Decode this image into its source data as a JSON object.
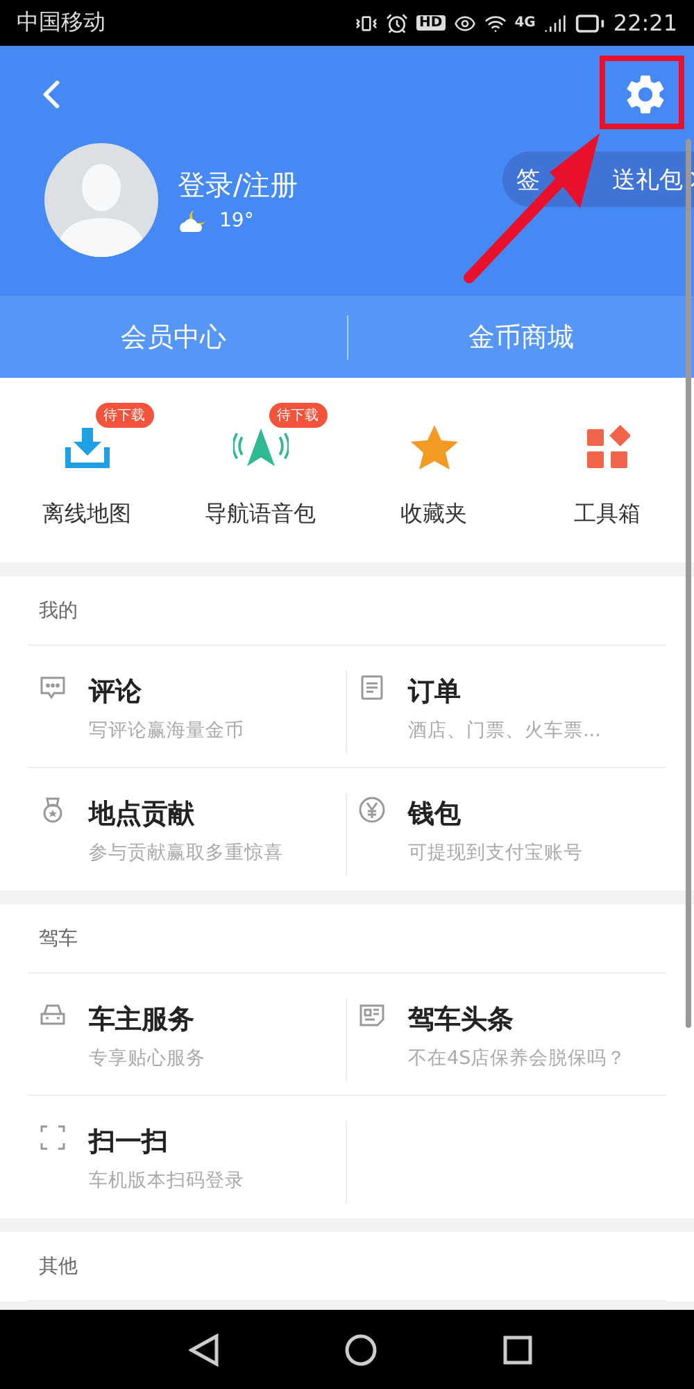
{
  "status_bar": {
    "carrier": "中国移动",
    "hd_label": "HD",
    "network": "4G",
    "time": "22:21"
  },
  "profile": {
    "name": "登录/注册",
    "temperature": "19°",
    "sign_in_parts": [
      "签",
      "送礼包"
    ]
  },
  "member_tabs": [
    {
      "label": "会员中心"
    },
    {
      "label": "金币商城"
    }
  ],
  "shortcuts": [
    {
      "label": "离线地图",
      "badge": "待下载",
      "kind": "download"
    },
    {
      "label": "导航语音包",
      "badge": "待下载",
      "kind": "voice"
    },
    {
      "label": "收藏夹",
      "kind": "star"
    },
    {
      "label": "工具箱",
      "kind": "tools"
    }
  ],
  "sections": [
    {
      "title": "我的",
      "items": [
        {
          "title": "评论",
          "subtitle": "写评论赢海量金币",
          "kind": "comment"
        },
        {
          "title": "订单",
          "subtitle": "酒店、门票、火车票...",
          "kind": "order"
        },
        {
          "title": "地点贡献",
          "subtitle": "参与贡献赢取多重惊喜",
          "kind": "medal"
        },
        {
          "title": "钱包",
          "subtitle": "可提现到支付宝账号",
          "kind": "yen"
        }
      ]
    },
    {
      "title": "驾车",
      "items": [
        {
          "title": "车主服务",
          "subtitle": "专享贴心服务",
          "kind": "car"
        },
        {
          "title": "驾车头条",
          "subtitle": "不在4S店保养会脱保吗？",
          "kind": "news"
        },
        {
          "title": "扫一扫",
          "subtitle": "车机版本扫码登录",
          "kind": "scan"
        }
      ]
    },
    {
      "title": "其他"
    }
  ]
}
